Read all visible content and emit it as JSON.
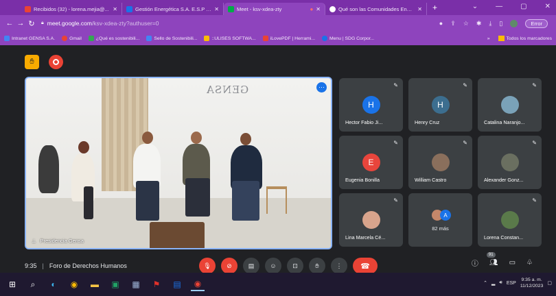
{
  "browser": {
    "tabs": [
      {
        "label": "Recibidos (32) - lorena.mejia@...",
        "color": "#ea4335"
      },
      {
        "label": "Gestión Energética S.A. E.S.P - C",
        "color": "#1a73e8"
      },
      {
        "label": "Meet - ksv-xdea-zty",
        "color": "#00ac47",
        "active": true
      },
      {
        "label": "Qué son las Comunidades Ener...",
        "color": "#ffffff"
      }
    ],
    "url_host": "meet.google.com",
    "url_path": "/ksv-xdea-zty?authuser=0",
    "profile_label": "Error",
    "bookmarks": [
      {
        "label": "Intranet GENSA S.A.",
        "color": "#4285f4"
      },
      {
        "label": "Gmail",
        "color": "#ea4335"
      },
      {
        "label": "¿Qué es sostenibili...",
        "color": "#34a853"
      },
      {
        "label": "Sello de Sostenibili...",
        "color": "#4285f4"
      },
      {
        "label": "::ULISES SOFTWA...",
        "color": "#fbbc04"
      },
      {
        "label": "iLovePDF | Herrami...",
        "color": "#ea4335"
      },
      {
        "label": "Menu | SDG Corpor...",
        "color": "#1a73e8"
      }
    ],
    "bookmarks_all": "Todos los marcadores"
  },
  "meet": {
    "presenter_label": "Presidencia Gensa",
    "wall_logo": "GENSA",
    "participants": [
      {
        "name": "Hector Fabio Ji...",
        "initial": "H",
        "color": "#1a73e8"
      },
      {
        "name": "Henry Cruz",
        "initial": "H",
        "color": "#3c6e8f"
      },
      {
        "name": "Catalina Naranjo...",
        "initial": "",
        "color": "#7aa2b8"
      },
      {
        "name": "Eugenia Bonilla",
        "initial": "E",
        "color": "#e8453c"
      },
      {
        "name": "William Castro",
        "initial": "",
        "color": "#8a6f5c"
      },
      {
        "name": "Alexander Gonz...",
        "initial": "",
        "color": "#6a6f60"
      },
      {
        "name": "Lina Marcela Cé...",
        "initial": "",
        "color": "#d8a48c"
      },
      {
        "name": "82 más",
        "initial": "A",
        "color": "#1a73e8"
      },
      {
        "name": "Lorena Constan...",
        "initial": "",
        "color": "#5a7a4a"
      }
    ],
    "time": "9:35",
    "separator": "|",
    "meeting_name": "Foro de Derechos Humanos",
    "people_count": "91"
  },
  "taskbar": {
    "lang": "ESP",
    "clock_time": "9:35 a. m.",
    "clock_date": "11/12/2023"
  }
}
